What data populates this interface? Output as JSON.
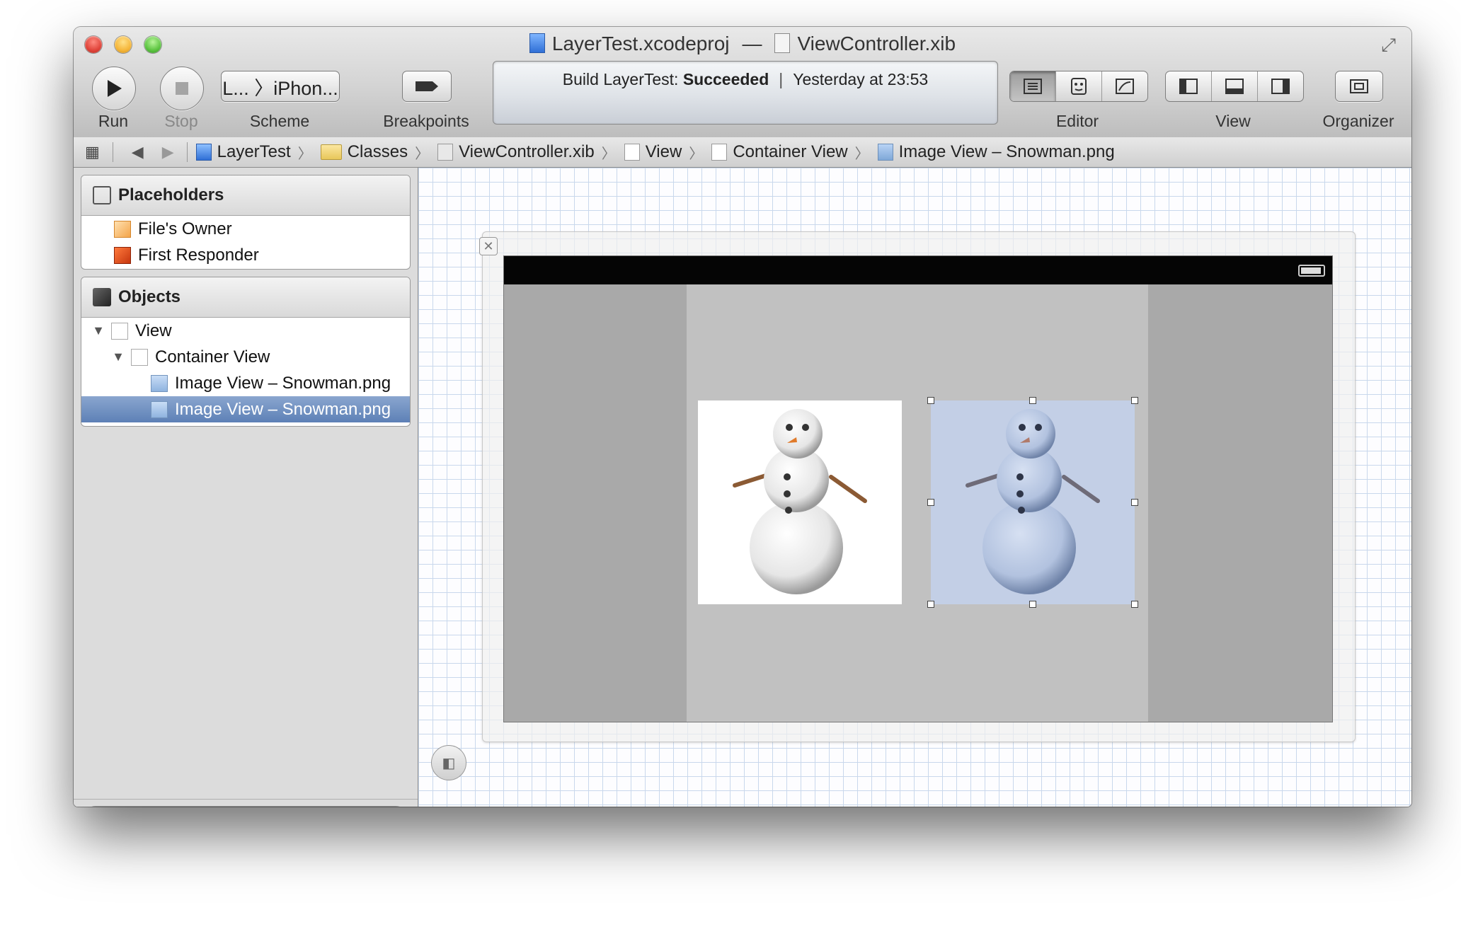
{
  "window": {
    "title_project": "LayerTest.xcodeproj",
    "title_separator": "—",
    "title_file": "ViewController.xib"
  },
  "toolbar": {
    "run_label": "Run",
    "stop_label": "Stop",
    "scheme_value": "L... 〉iPhon...",
    "scheme_label": "Scheme",
    "breakpoints_label": "Breakpoints",
    "editor_label": "Editor",
    "view_label": "View",
    "organizer_label": "Organizer"
  },
  "activity": {
    "prefix": "Build LayerTest: ",
    "status": "Succeeded",
    "time": "Yesterday at 23:53"
  },
  "jumpbar": {
    "crumbs": [
      "LayerTest",
      "Classes",
      "ViewController.xib",
      "View",
      "Container View",
      "Image View – Snowman.png"
    ]
  },
  "outline": {
    "placeholders_header": "Placeholders",
    "placeholders": [
      "File's Owner",
      "First Responder"
    ],
    "objects_header": "Objects",
    "objects": [
      {
        "label": "View",
        "level": 0,
        "expanded": true
      },
      {
        "label": "Container View",
        "level": 1,
        "expanded": true
      },
      {
        "label": "Image View – Snowman.png",
        "level": 2,
        "selected": false
      },
      {
        "label": "Image View – Snowman.png",
        "level": 2,
        "selected": true
      }
    ]
  },
  "colors": {
    "selection": "#5d80b6",
    "canvas_grid": "#c9d8ec",
    "status_bar": "#050505",
    "container_view": "#c1c1c1",
    "tinted_image": "#c3cfe6"
  },
  "icons": {
    "run": "play-icon",
    "stop": "stop-icon",
    "breakpoints": "breakpoint-arrow-icon",
    "organizer": "organizer-icon"
  }
}
